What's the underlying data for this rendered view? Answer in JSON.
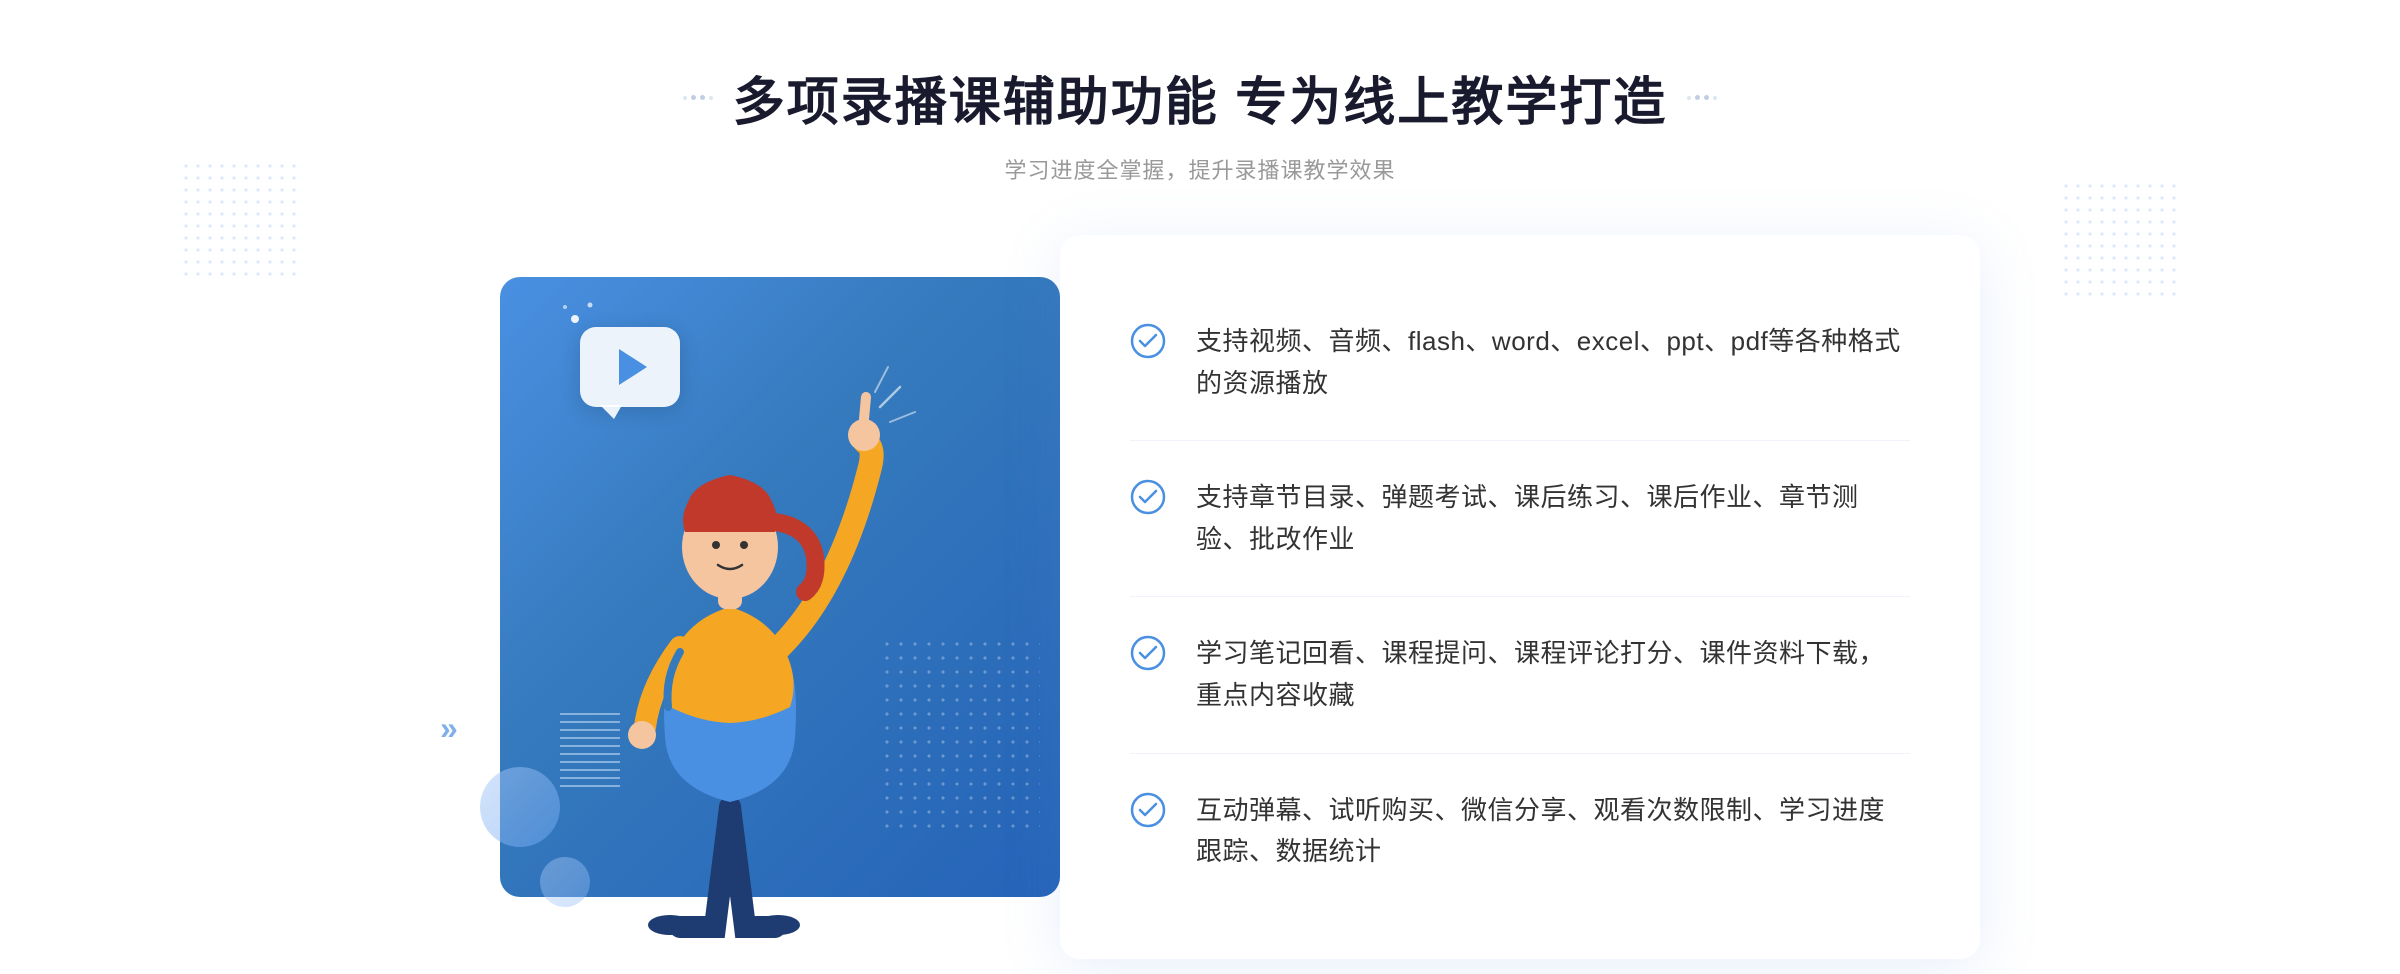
{
  "header": {
    "title": "多项录播课辅助功能 专为线上教学打造",
    "subtitle": "学习进度全掌握，提升录播课教学效果"
  },
  "features": [
    {
      "id": 1,
      "text": "支持视频、音频、flash、word、excel、ppt、pdf等各种格式的资源播放"
    },
    {
      "id": 2,
      "text": "支持章节目录、弹题考试、课后练习、课后作业、章节测验、批改作业"
    },
    {
      "id": 3,
      "text": "学习笔记回看、课程提问、课程评论打分、课件资料下载，重点内容收藏"
    },
    {
      "id": 4,
      "text": "互动弹幕、试听购买、微信分享、观看次数限制、学习进度跟踪、数据统计"
    }
  ],
  "colors": {
    "primary_blue": "#4a90e2",
    "dark_blue": "#2563b8",
    "text_dark": "#1a1a2e",
    "text_gray": "#999999",
    "text_body": "#333333",
    "white": "#ffffff",
    "border": "#f0f4fa"
  }
}
